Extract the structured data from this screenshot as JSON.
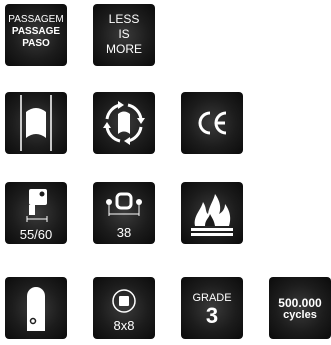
{
  "tiles": {
    "passage": {
      "line1": "PASSAGEM",
      "line2": "PASSAGE",
      "line3": "PASO"
    },
    "less_is_more": {
      "line1": "LESS",
      "line2": "IS",
      "line3": "MORE"
    },
    "frame": {
      "icon": "door-frame-icon"
    },
    "reversible": {
      "icon": "reversible-door-arrows-icon"
    },
    "ce": {
      "text": "CE"
    },
    "backset": {
      "icon": "lock-backset-icon",
      "label": "55/60"
    },
    "spacing": {
      "icon": "handle-spacing-icon",
      "label": "38"
    },
    "fire": {
      "icon": "fire-icon"
    },
    "escutcheon": {
      "icon": "door-escutcheon-icon"
    },
    "spindle": {
      "icon": "square-spindle-icon",
      "label": "8x8"
    },
    "grade": {
      "label": "GRADE",
      "value": "3"
    },
    "cycles": {
      "value": "500.000",
      "unit": "cycles"
    }
  },
  "colors": {
    "tile_background": "#1c1c1c",
    "icon_color": "#ffffff",
    "page_background": "#ffffff"
  }
}
